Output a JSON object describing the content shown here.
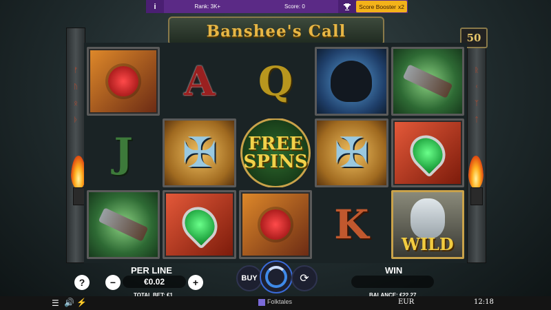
{
  "topbar": {
    "info_icon": "info-icon",
    "rank": "Rank: 3K+",
    "score": "Score: 0",
    "trophy_icon": "trophy-icon",
    "booster_label": "Score Booster",
    "booster_mult": "x2"
  },
  "game": {
    "title": "Banshee's Call",
    "lines": "50"
  },
  "reels": [
    [
      "rose",
      "A",
      "Q",
      "raven",
      "pistol"
    ],
    [
      "J",
      "celtic-cross",
      "FREE SPINS",
      "celtic-cross",
      "claddagh-ring"
    ],
    [
      "pistol",
      "claddagh-ring",
      "rose",
      "K",
      "WILD"
    ]
  ],
  "symbols": {
    "letter_a": "A",
    "letter_q": "Q",
    "letter_j": "J",
    "letter_k": "K",
    "free_spins_line1": "FREE",
    "free_spins_line2": "SPINS",
    "wild": "WILD"
  },
  "controls": {
    "help_label": "?",
    "minus_label": "−",
    "plus_label": "+",
    "per_line_label": "PER LINE",
    "per_line_value": "€0.02",
    "total_bet": "TOTAL BET: €1",
    "buy_label": "BUY",
    "win_label": "WIN",
    "win_value": "",
    "balance": "BALANCE: €22.27"
  },
  "footer": {
    "brand": "Folktales",
    "currency": "EUR",
    "time": "12:18"
  },
  "colors": {
    "topbar": "#5b2a86",
    "booster": "#f3b21a",
    "title_gold": "#e7b645",
    "spin_accent": "#3f8ae8"
  }
}
